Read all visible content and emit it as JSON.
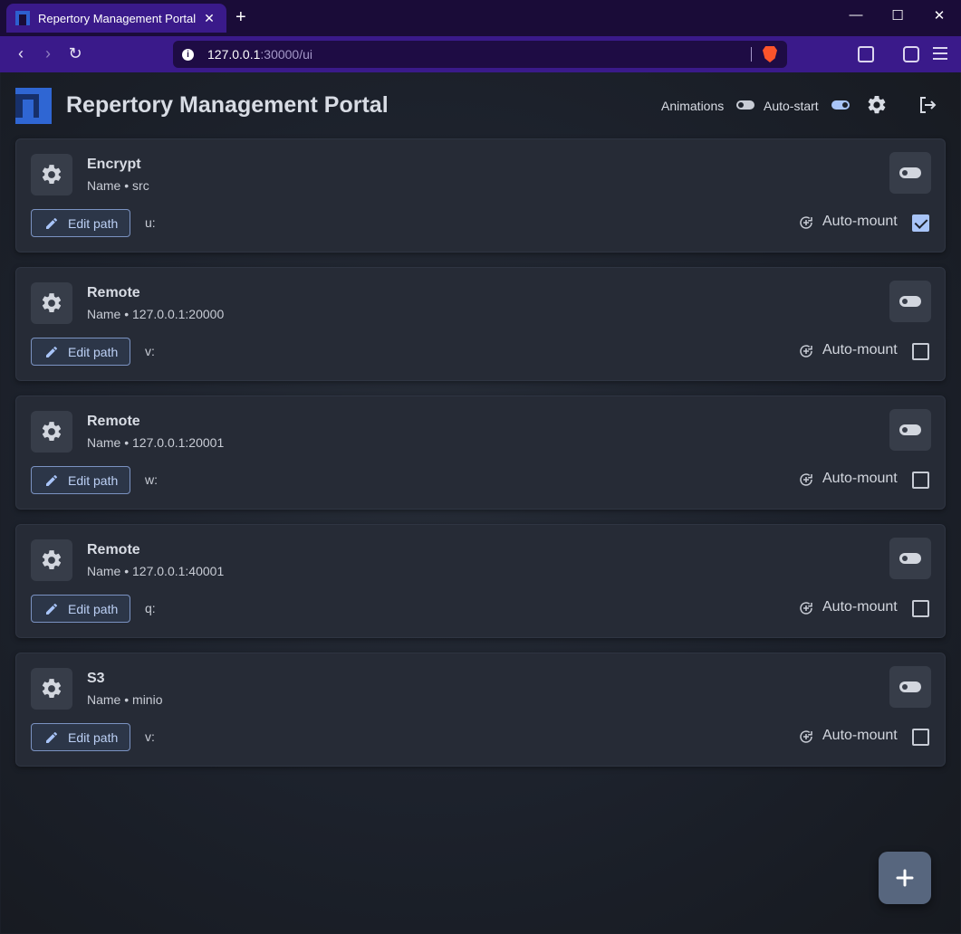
{
  "browser": {
    "tab_title": "Repertory Management Portal",
    "tab_close": "✕",
    "new_tab": "+",
    "url_host": "127.0.0.1",
    "url_path": ":30000/ui",
    "info_glyph": "i",
    "window_controls": {
      "minimize": "—",
      "maximize": "☐",
      "close": "✕"
    },
    "nav": {
      "back": "‹",
      "forward": "›",
      "reload": "↻"
    }
  },
  "header": {
    "title": "Repertory Management Portal",
    "animations_label": "Animations",
    "animations_enabled": false,
    "autostart_label": "Auto-start",
    "autostart_enabled": true
  },
  "mounts": [
    {
      "title": "Encrypt",
      "name": "Name • src",
      "edit_label": "Edit path",
      "path": "u:",
      "automount_label": "Auto-mount",
      "automount": true
    },
    {
      "title": "Remote",
      "name": "Name • 127.0.0.1:20000",
      "edit_label": "Edit path",
      "path": "v:",
      "automount_label": "Auto-mount",
      "automount": false
    },
    {
      "title": "Remote",
      "name": "Name • 127.0.0.1:20001",
      "edit_label": "Edit path",
      "path": "w:",
      "automount_label": "Auto-mount",
      "automount": false
    },
    {
      "title": "Remote",
      "name": "Name • 127.0.0.1:40001",
      "edit_label": "Edit path",
      "path": "q:",
      "automount_label": "Auto-mount",
      "automount": false
    },
    {
      "title": "S3",
      "name": "Name • minio",
      "edit_label": "Edit path",
      "path": "v:",
      "automount_label": "Auto-mount",
      "automount": false
    }
  ],
  "colors": {
    "accent": "#a8c4f8",
    "brand": "#2f66d3",
    "tab_bg": "#3a1a8a"
  }
}
